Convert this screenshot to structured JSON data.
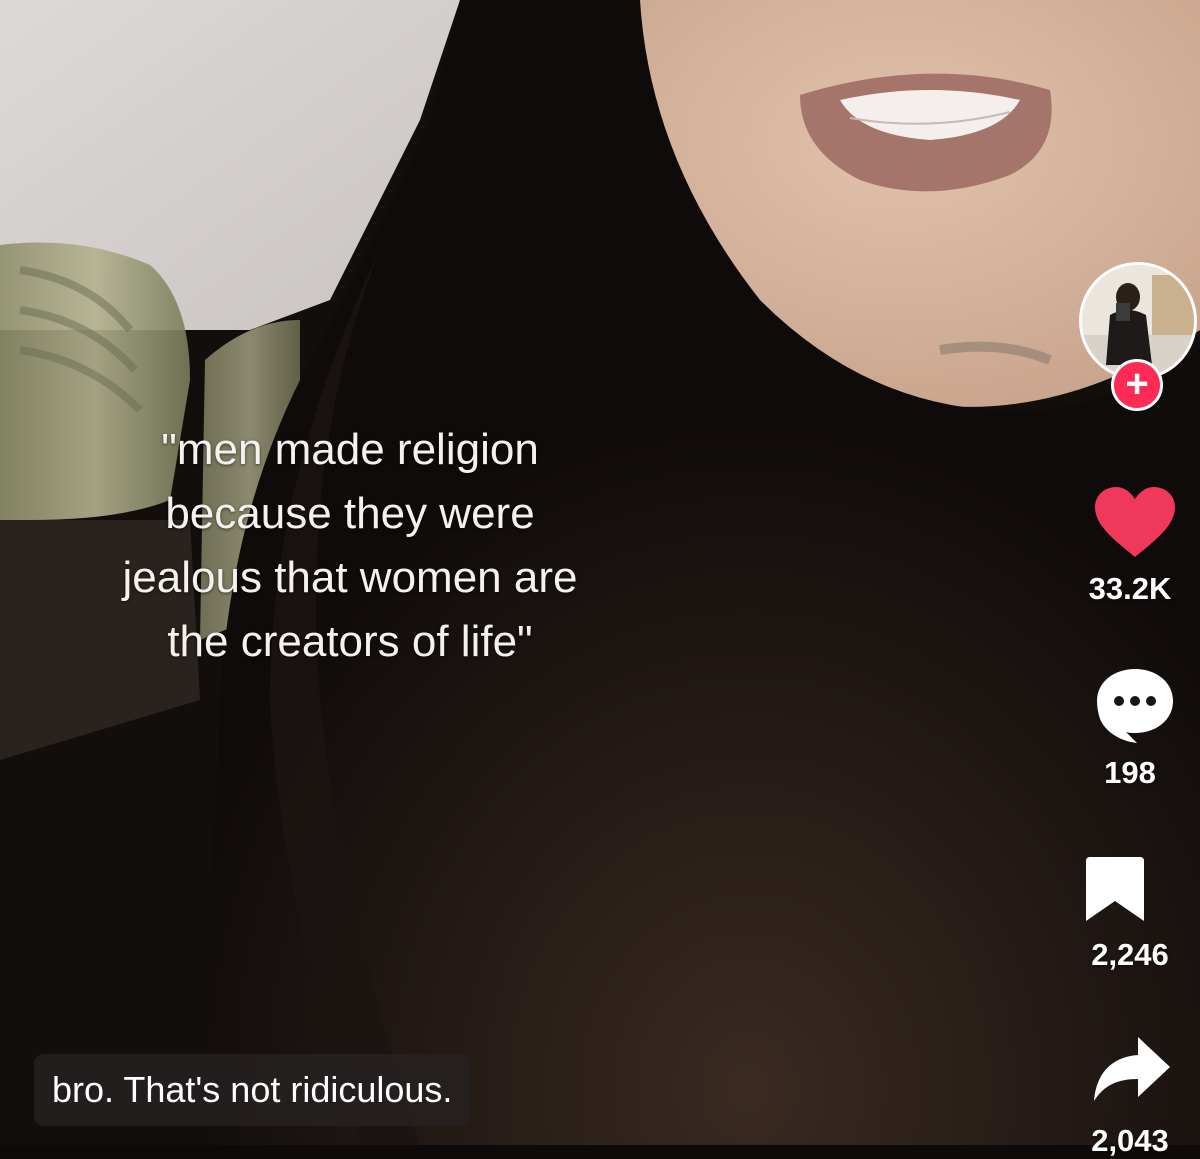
{
  "video": {
    "overlay_lines": [
      "\"men made religion",
      "because they were",
      "jealous that women are",
      "the creators of life\""
    ],
    "caption": "bro. That's not ridiculous."
  },
  "actions": {
    "follow_glyph": "+",
    "like_count": "33.2K",
    "comment_count": "198",
    "bookmark_count": "2,246",
    "share_count": "2,043"
  },
  "colors": {
    "accent": "#fe2c55",
    "heart": "#f0395a",
    "text": "#ffffff"
  }
}
